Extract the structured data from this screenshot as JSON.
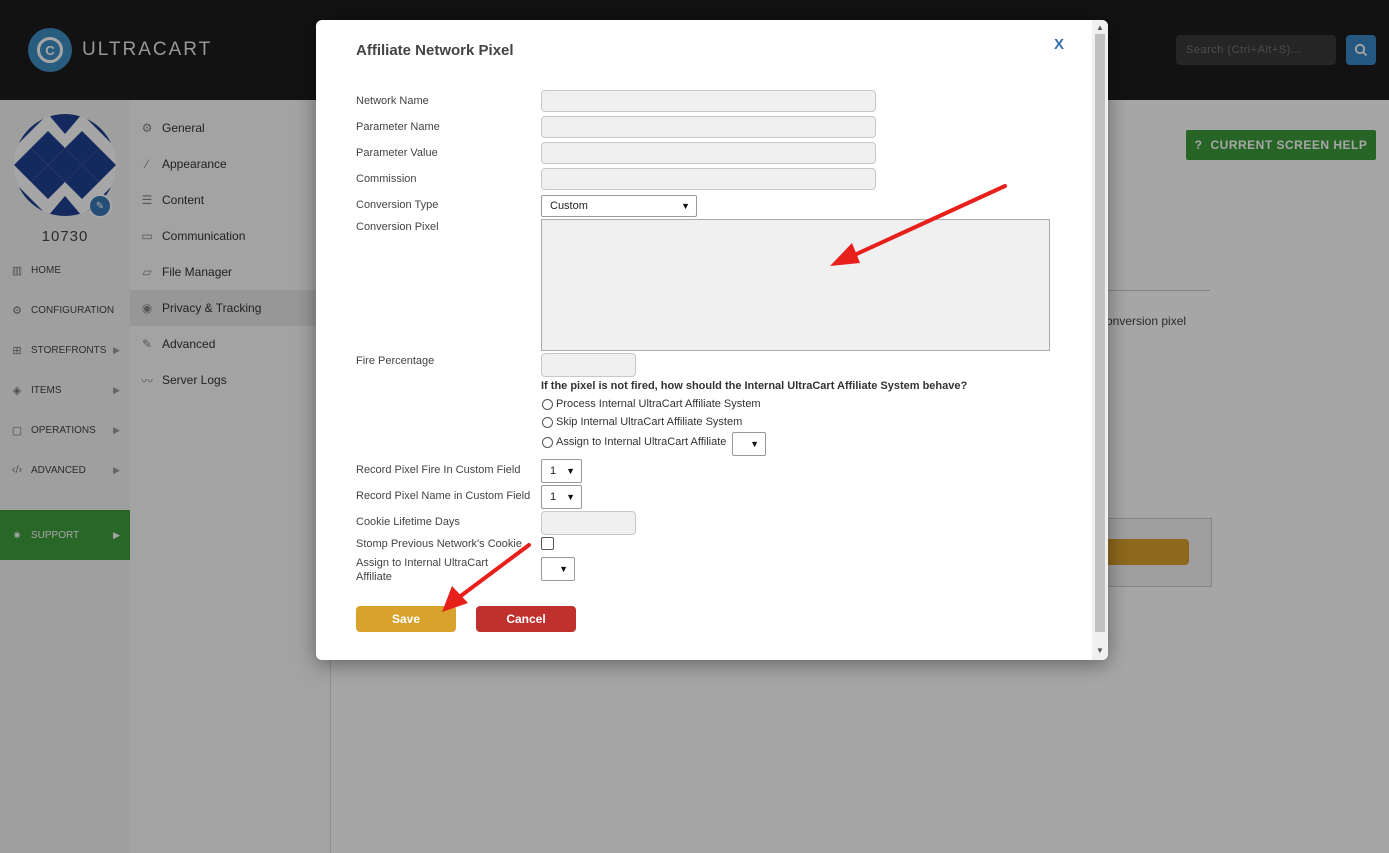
{
  "app": {
    "brand": "ULTRACART",
    "search_placeholder": "Search (Ctrl+Alt+S)..."
  },
  "account": {
    "id": "10730"
  },
  "left_nav": [
    {
      "label": "HOME",
      "icon": "chart-icon"
    },
    {
      "label": "CONFIGURATION",
      "icon": "gear-icon"
    },
    {
      "label": "STOREFRONTS",
      "icon": "cart-icon"
    },
    {
      "label": "ITEMS",
      "icon": "tags-icon"
    },
    {
      "label": "OPERATIONS",
      "icon": "clipboard-icon"
    },
    {
      "label": "ADVANCED",
      "icon": "code-icon"
    },
    {
      "label": "SUPPORT",
      "icon": "lightbulb-icon"
    }
  ],
  "sub_nav": [
    {
      "label": "General",
      "icon": "gear-icon"
    },
    {
      "label": "Appearance",
      "icon": "brush-icon"
    },
    {
      "label": "Content",
      "icon": "list-icon"
    },
    {
      "label": "Communication",
      "icon": "chat-icon"
    },
    {
      "label": "File Manager",
      "icon": "folder-icon"
    },
    {
      "label": "Privacy & Tracking",
      "icon": "eye-icon"
    },
    {
      "label": "Advanced",
      "icon": "wrench-icon"
    },
    {
      "label": "Server Logs",
      "icon": "pulse-icon"
    }
  ],
  "background": {
    "help_button": "CURRENT SCREEN HELP",
    "partial_text": "onversion pixel"
  },
  "modal": {
    "title": "Affiliate Network Pixel",
    "close": "X",
    "fields": {
      "network_name": {
        "label": "Network Name",
        "value": ""
      },
      "parameter_name": {
        "label": "Parameter Name",
        "value": ""
      },
      "parameter_value": {
        "label": "Parameter Value",
        "value": ""
      },
      "commission": {
        "label": "Commission",
        "value": ""
      },
      "conversion_type": {
        "label": "Conversion Type",
        "value": "Custom"
      },
      "conversion_pixel": {
        "label": "Conversion Pixel",
        "value": ""
      },
      "fire_percentage": {
        "label": "Fire Percentage",
        "value": ""
      },
      "record_fire": {
        "label": "Record Pixel Fire In Custom Field",
        "value": "1"
      },
      "record_name": {
        "label": "Record Pixel Name in Custom Field",
        "value": "1"
      },
      "cookie_days": {
        "label": "Cookie Lifetime Days",
        "value": ""
      },
      "stomp_cookie": {
        "label": "Stomp Previous Network's Cookie"
      },
      "assign_affiliate": {
        "label": "Assign to Internal UltraCart Affiliate",
        "value": ""
      }
    },
    "not_fired_question": "If the pixel is not fired, how should the Internal UltraCart Affiliate System behave?",
    "radio_options": [
      "Process Internal UltraCart Affiliate System",
      "Skip Internal UltraCart Affiliate System",
      "Assign to Internal UltraCart Affiliate"
    ],
    "save_label": "Save",
    "cancel_label": "Cancel"
  },
  "colors": {
    "save": "#d9a22d",
    "cancel": "#c0312e",
    "support": "#3e9e3e",
    "annotation_arrow": "#e8201c"
  }
}
